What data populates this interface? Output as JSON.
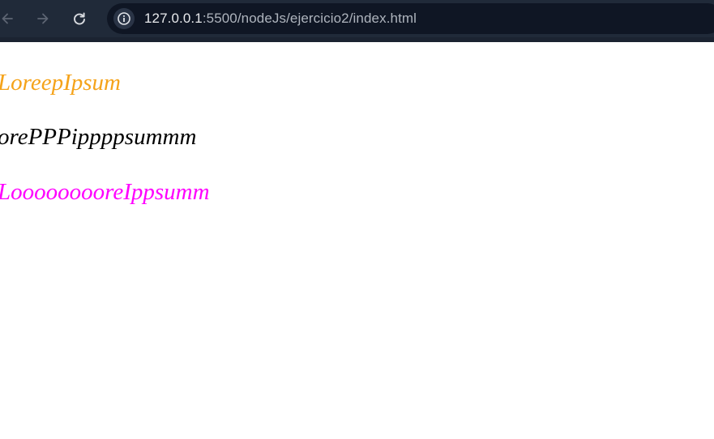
{
  "browser": {
    "url_host": "127.0.0.1",
    "url_rest": ":5500/nodeJs/ejercicio2/index.html",
    "icons": {
      "back": "arrow-left-icon",
      "forward": "arrow-right-icon",
      "reload": "reload-icon",
      "site_info": "info-icon"
    }
  },
  "page": {
    "lines": [
      {
        "text": "LoreepIpsum",
        "color": "#f5a31a"
      },
      {
        "text": "orePPPippppsummm",
        "color": "#000000"
      },
      {
        "text": "LooooooooreIppsumm",
        "color": "#ff00ff"
      }
    ]
  }
}
